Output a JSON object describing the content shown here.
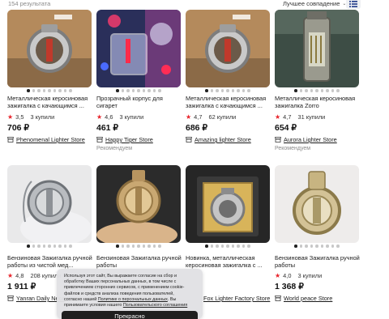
{
  "header": {
    "results_count": "154 результата",
    "sort_label": "Лучшее совпадение",
    "sort_chevron": "⌄",
    "view_icon": "list-view-icon"
  },
  "products": [
    {
      "title_1": "Металлическая керосиновая",
      "title_2": "зажигалка с качающимся ...",
      "rating": "3,5",
      "bought": "3 купили",
      "price": "706 ₽",
      "store": "Phenomenal Lighter Store",
      "recommended": "",
      "image": "silver-ring-lighter"
    },
    {
      "title_1": "Прозрачный корпус для",
      "title_2": "сигарет",
      "rating": "4,6",
      "bought": "3 купили",
      "price": "461 ₽",
      "store": "Happy Tiger Store",
      "recommended": "Рекомендуем",
      "image": "transparent-case"
    },
    {
      "title_1": "Металлическая керосиновая",
      "title_2": "зажигалка с качающимся ...",
      "rating": "4,7",
      "bought": "62 купили",
      "price": "686 ₽",
      "store": "Amazing lighter Store",
      "recommended": "",
      "image": "silver-ring-lighter"
    },
    {
      "title_1": "Металлическая керосиновая",
      "title_2": "зажигалка Zorro",
      "rating": "4,7",
      "bought": "31 купили",
      "price": "654 ₽",
      "store": "Aurora Lighter Store",
      "recommended": "Рекомендуем",
      "image": "zorro-lighter"
    },
    {
      "title_1": "Бензиновая Зажигалка ручной",
      "title_2": "работы из чистой мед...",
      "rating": "4,8",
      "bought": "208 купили",
      "price": "1 911 ₽",
      "store": "Yanran Daily Nece",
      "recommended": "",
      "image": "hand-silver-lighter"
    },
    {
      "title_1": "Бензиновая Зажигалка ручной",
      "title_2": "работы",
      "rating": "",
      "bought": "",
      "price": "",
      "store": "",
      "recommended": "",
      "image": "hand-gold-lighter"
    },
    {
      "title_1": "Новинка, металлическая",
      "title_2": "керосиновая зажигалка с ...",
      "rating": "",
      "bought": "",
      "price": "",
      "store": "Fox Lighter Factory Store",
      "recommended": "",
      "image": "boxed-lighter"
    },
    {
      "title_1": "Бензиновая Зажигалка ручной",
      "title_2": "работы",
      "rating": "4,0",
      "bought": "3 купили",
      "price": "1 368 ₽",
      "store": "World peace Store",
      "recommended": "",
      "image": "gold-wheel-lighter"
    }
  ],
  "cookie": {
    "line_1": "Используя этот сайт, Вы выражаете согласие на сбор и",
    "line_2": "обработку Ваших персональных данных, в том числе с",
    "line_3": "привлечением сторонних сервисов, с применением cookie-",
    "line_4": "файлов и средств анализа поведения пользователей,",
    "line_5a": "согласно нашей ",
    "line_5_link": "Политике о персональных данных",
    "line_5b": ". Вы",
    "line_6a": "принимаете условия нашего ",
    "line_6_link": "Пользовательского соглашения",
    "button": "Прекрасно"
  },
  "colors": {
    "star": "#e8242b",
    "button": "#1f1f1f"
  }
}
